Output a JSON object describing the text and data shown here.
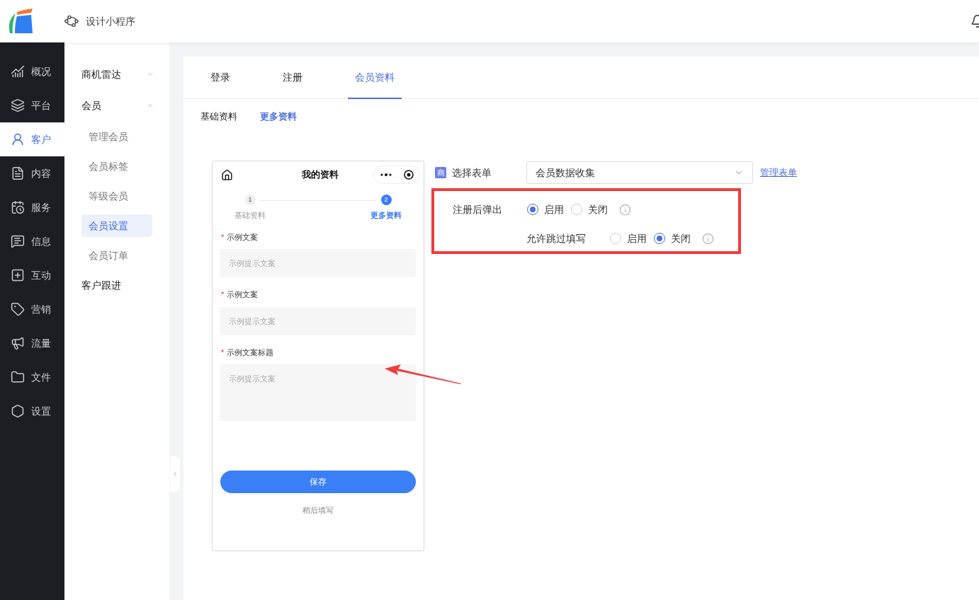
{
  "header": {
    "title": "设计小程序"
  },
  "nav": {
    "items": [
      {
        "label": "概况",
        "selected": false
      },
      {
        "label": "平台",
        "selected": false
      },
      {
        "label": "客户",
        "selected": true
      },
      {
        "label": "内容",
        "selected": false
      },
      {
        "label": "服务",
        "selected": false
      },
      {
        "label": "信息",
        "selected": false
      },
      {
        "label": "互动",
        "selected": false
      },
      {
        "label": "营销",
        "selected": false
      },
      {
        "label": "流量",
        "selected": false
      },
      {
        "label": "文件",
        "selected": false
      },
      {
        "label": "设置",
        "selected": false
      }
    ]
  },
  "subnav": {
    "items": [
      {
        "label": "商机雷达",
        "kind": "group",
        "expanded": false
      },
      {
        "label": "会员",
        "kind": "group",
        "expanded": true,
        "children": [
          {
            "label": "管理会员",
            "selected": false
          },
          {
            "label": "会员标签",
            "selected": false
          },
          {
            "label": "等级会员",
            "selected": false
          },
          {
            "label": "会员设置",
            "selected": true
          },
          {
            "label": "会员订单",
            "selected": false
          }
        ]
      },
      {
        "label": "客户跟进",
        "kind": "link"
      }
    ]
  },
  "tabs": [
    {
      "label": "登录",
      "selected": false
    },
    {
      "label": "注册",
      "selected": false
    },
    {
      "label": "会员资料",
      "selected": true
    }
  ],
  "subtabs": [
    {
      "label": "基础资料",
      "selected": false
    },
    {
      "label": "更多资料",
      "selected": true
    }
  ],
  "phone": {
    "title": "我的资料",
    "steps": [
      {
        "number": "1",
        "label": "基础资料",
        "active": false
      },
      {
        "number": "2",
        "label": "更多资料",
        "active": true
      }
    ],
    "fields": [
      {
        "label": "示例文案",
        "required_mark": "*",
        "placeholder": "示例提示文案",
        "kind": "input"
      },
      {
        "label": "示例文案",
        "required_mark": "*",
        "placeholder": "示例提示文案",
        "kind": "input"
      },
      {
        "label": "示例文案标题",
        "required_mark": "*",
        "placeholder": "示例提示文案",
        "kind": "textarea"
      }
    ],
    "save_button": "保存",
    "later_link": "稍后填写"
  },
  "form": {
    "badge": "商",
    "select_label": "选择表单",
    "select_value": "会员数据收集",
    "manage_link": "管理表单",
    "options": [
      {
        "label": "注册后弹出",
        "choices": [
          {
            "label": "启用",
            "selected": true
          },
          {
            "label": "关闭",
            "selected": false
          }
        ]
      },
      {
        "label": "允许跳过填写",
        "choices": [
          {
            "label": "启用",
            "selected": false
          },
          {
            "label": "关闭",
            "selected": true
          }
        ]
      }
    ]
  }
}
